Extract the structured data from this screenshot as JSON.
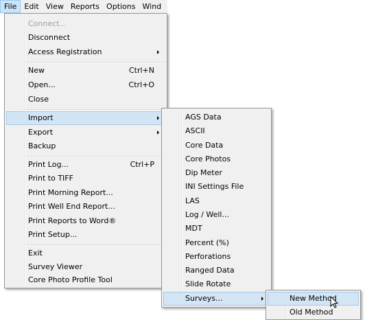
{
  "menubar": {
    "items": [
      "File",
      "Edit",
      "View",
      "Reports",
      "Options",
      "Wind"
    ]
  },
  "file_menu": {
    "connect": "Connect...",
    "disconnect": "Disconnect",
    "access_registration": "Access Registration",
    "new": "New",
    "new_shortcut": "Ctrl+N",
    "open": "Open...",
    "open_shortcut": "Ctrl+O",
    "close": "Close",
    "import": "Import",
    "export": "Export",
    "backup": "Backup",
    "print_log": "Print Log...",
    "print_log_shortcut": "Ctrl+P",
    "print_to_tiff": "Print to TIFF",
    "print_morning_report": "Print Morning Report...",
    "print_well_end_report": "Print Well End Report...",
    "print_reports_to_word": "Print Reports to Word®",
    "print_setup": "Print Setup...",
    "exit": "Exit",
    "survey_viewer": "Survey Viewer",
    "core_photo_profile_tool": "Core Photo Profile Tool"
  },
  "import_menu": {
    "items": [
      "AGS Data",
      "ASCII",
      "Core Data",
      "Core Photos",
      "Dip Meter",
      "INI Settings File",
      "LAS",
      "Log / Well...",
      "MDT",
      "Percent (%)",
      "Perforations",
      "Ranged Data",
      "Slide Rotate",
      "Surveys..."
    ]
  },
  "surveys_menu": {
    "items": [
      "New Method",
      "Old Method"
    ]
  },
  "colors": {
    "menu_bg": "#f0f0f0",
    "highlight_bg": "#d3e5f4",
    "highlight_border": "#a6c8e6",
    "disabled_text": "#a0a0a0"
  },
  "icons": {
    "submenu_arrow": "chevron-right-icon",
    "cursor": "mouse-pointer-icon"
  }
}
